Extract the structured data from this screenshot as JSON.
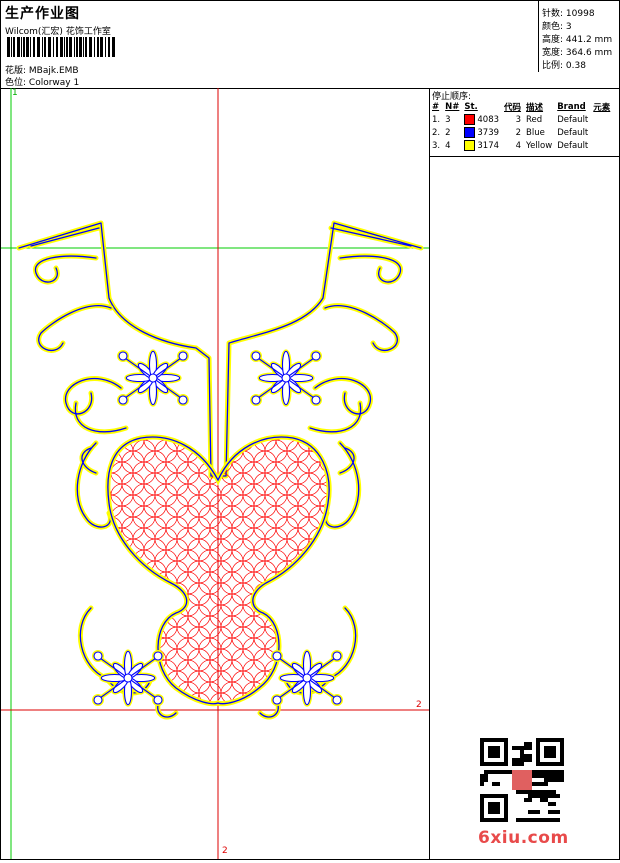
{
  "header": {
    "title": "生产作业图",
    "company": "Wilcom(汇宏)",
    "company_suffix": "花饰工作室"
  },
  "design_info": {
    "pattern_label": "花版:",
    "pattern_value": "MBajk.EMB",
    "colorway_label": "色位:",
    "colorway_value": "Colorway 1"
  },
  "stats": {
    "stitches_label": "针数:",
    "stitches_value": "10998",
    "colors_label": "颜色:",
    "colors_value": "3",
    "height_label": "高度:",
    "height_value": "441.2 mm",
    "width_label": "宽度:",
    "width_value": "364.6 mm",
    "scale_label": "比例:",
    "scale_value": "0.38"
  },
  "stop_sequence": {
    "title": "停止顺序:",
    "columns": [
      "#",
      "N#",
      "St.",
      "代码",
      "描述",
      "Brand",
      "元素"
    ],
    "rows": [
      {
        "num": "1.",
        "n": "3",
        "color": "#ff0000",
        "st": "4083",
        "code": "3",
        "desc": "Red",
        "brand": "Default"
      },
      {
        "num": "2.",
        "n": "2",
        "color": "#0000ff",
        "st": "3739",
        "code": "2",
        "desc": "Blue",
        "brand": "Default"
      },
      {
        "num": "3.",
        "n": "4",
        "color": "#ffff00",
        "st": "3174",
        "code": "4",
        "desc": "Yellow",
        "brand": "Default"
      }
    ]
  },
  "guides": {
    "left_marker": "1",
    "right_marker": "2",
    "bottom_marker": "2"
  },
  "watermark": {
    "text": "6xiu.com"
  },
  "colors": {
    "thread_red": "#ff0000",
    "thread_blue": "#0000ff",
    "thread_yellow": "#ffff00",
    "guide_green": "#00cc00",
    "guide_red": "#dd0000"
  }
}
